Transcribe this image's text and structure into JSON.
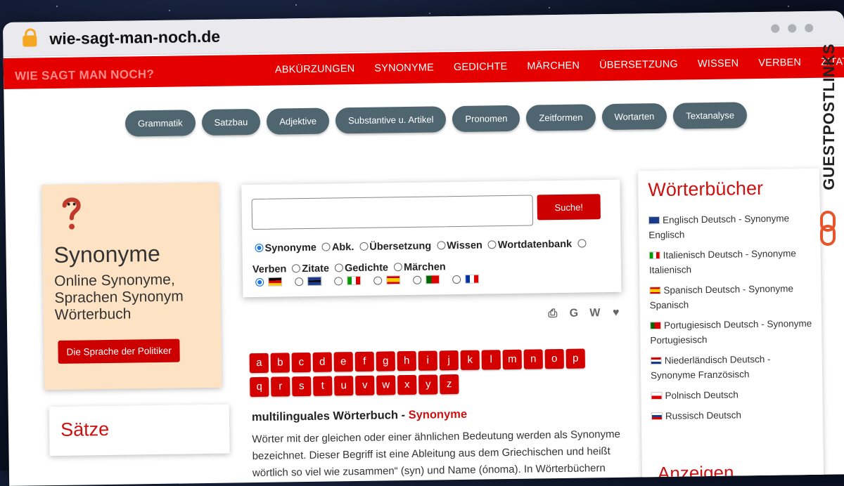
{
  "browser": {
    "url": "wie-sagt-man-noch.de"
  },
  "site": {
    "brand": "WIE SAGT MAN NOCH?",
    "nav": [
      "ABKÜRZUNGEN",
      "SYNONYME",
      "GEDICHTE",
      "MÄRCHEN",
      "ÜBERSETZUNG",
      "WISSEN",
      "VERBEN",
      "ZITATE"
    ]
  },
  "pills": [
    "Grammatik",
    "Satzbau",
    "Adjektive",
    "Substantive u. Artikel",
    "Pronomen",
    "Zeitformen",
    "Wortarten",
    "Textanalyse"
  ],
  "left_card": {
    "title": "Synonyme",
    "subtitle": "Online Synonyme, Sprachen Synonym Wörterbuch",
    "button": "Die Sprache der Politiker"
  },
  "satze": {
    "title": "Sätze"
  },
  "search": {
    "button": "Suche!",
    "options": [
      "Synonyme",
      "Abk.",
      "Übersetzung",
      "Wissen",
      "Wortdatenbank",
      "Verben",
      "Zitate",
      "Gedichte",
      "Märchen"
    ],
    "selected": "Synonyme"
  },
  "letters": [
    "a",
    "b",
    "c",
    "d",
    "e",
    "f",
    "g",
    "h",
    "i",
    "j",
    "k",
    "l",
    "m",
    "n",
    "o",
    "p",
    "q",
    "r",
    "s",
    "t",
    "u",
    "v",
    "w",
    "x",
    "y",
    "z"
  ],
  "article": {
    "title_prefix": "multilinguales Wörterbuch - ",
    "title_link": "Synonyme",
    "body": "Wörter mit der gleichen oder einer ähnlichen Bedeutung werden als Synonyme bezeichnet. Dieser Begriff ist eine Ableitung aus dem Griechischen und heißt wörtlich so viel wie zusammen“ (syn) und Name (ónoma). In Wörterbüchern und"
  },
  "woerterbuecher": {
    "title": "Wörterbücher",
    "items": [
      "Englisch Deutsch - Synonyme Englisch",
      "Italienisch Deutsch - Synonyme Italienisch",
      "Spanisch Deutsch - Synonyme Spanisch",
      "Portugiesisch Deutsch - Synonyme Portugiesisch",
      "Niederländisch Deutsch - Synonyme Französisch",
      "Polnisch Deutsch",
      "Russisch Deutsch"
    ]
  },
  "anzeigen": "Anzeigen",
  "watermark": "GUESTPOSTLINKS",
  "colors": {
    "nav_red": "#e50000",
    "pill": "#4f6670",
    "accent_red": "#cc1111"
  }
}
